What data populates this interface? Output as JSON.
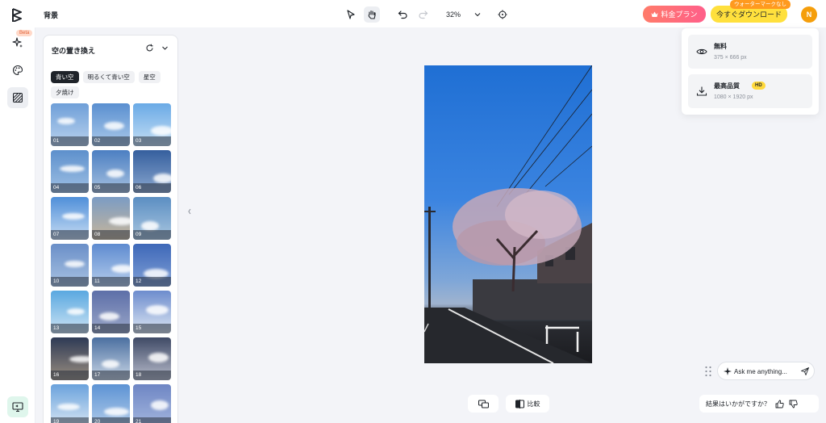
{
  "header": {
    "page_title": "背景",
    "zoom": "32%",
    "plan_button": "料金プラン",
    "download_button": "今すぐダウンロード",
    "watermark_badge": "ウォーターマークなし",
    "avatar_initial": "N"
  },
  "rail": {
    "beta_badge": "Beta"
  },
  "panel": {
    "title": "空の置き換え",
    "chips": [
      "青い空",
      "明るくて青い空",
      "星空",
      "夕焼け"
    ],
    "selected_chip": "青い空",
    "thumbnails": [
      "01",
      "02",
      "03",
      "04",
      "05",
      "06",
      "07",
      "08",
      "09",
      "10",
      "11",
      "12",
      "13",
      "14",
      "15",
      "16",
      "17",
      "18",
      "19",
      "20",
      "21"
    ]
  },
  "export": {
    "free_title": "無料",
    "free_size": "375 × 666 px",
    "hq_title": "最高品質",
    "hq_badge": "HD",
    "hq_size": "1080 × 1920 px"
  },
  "bottom": {
    "compare_label": "比較",
    "ask_placeholder": "Ask me anything...",
    "feedback_label": "結果はいかがですか？"
  },
  "colors": {
    "plan_gradient_start": "#ff7b6a",
    "plan_gradient_end": "#ff5f8a",
    "download_yellow": "#ffe03d",
    "avatar": "#f59e0b",
    "watermark_orange": "#ff9a1f"
  },
  "icons": [
    "logo-icon",
    "pointer-icon",
    "hand-icon",
    "undo-icon",
    "redo-icon",
    "chevron-down-icon",
    "target-icon",
    "crown-icon",
    "sparkle-icon",
    "palette-icon",
    "pattern-icon",
    "feedback-monitor-icon",
    "refresh-icon",
    "eye-icon",
    "download-icon",
    "compare-icon",
    "split-icon",
    "send-icon",
    "thumbs-up-icon",
    "thumbs-down-icon"
  ]
}
